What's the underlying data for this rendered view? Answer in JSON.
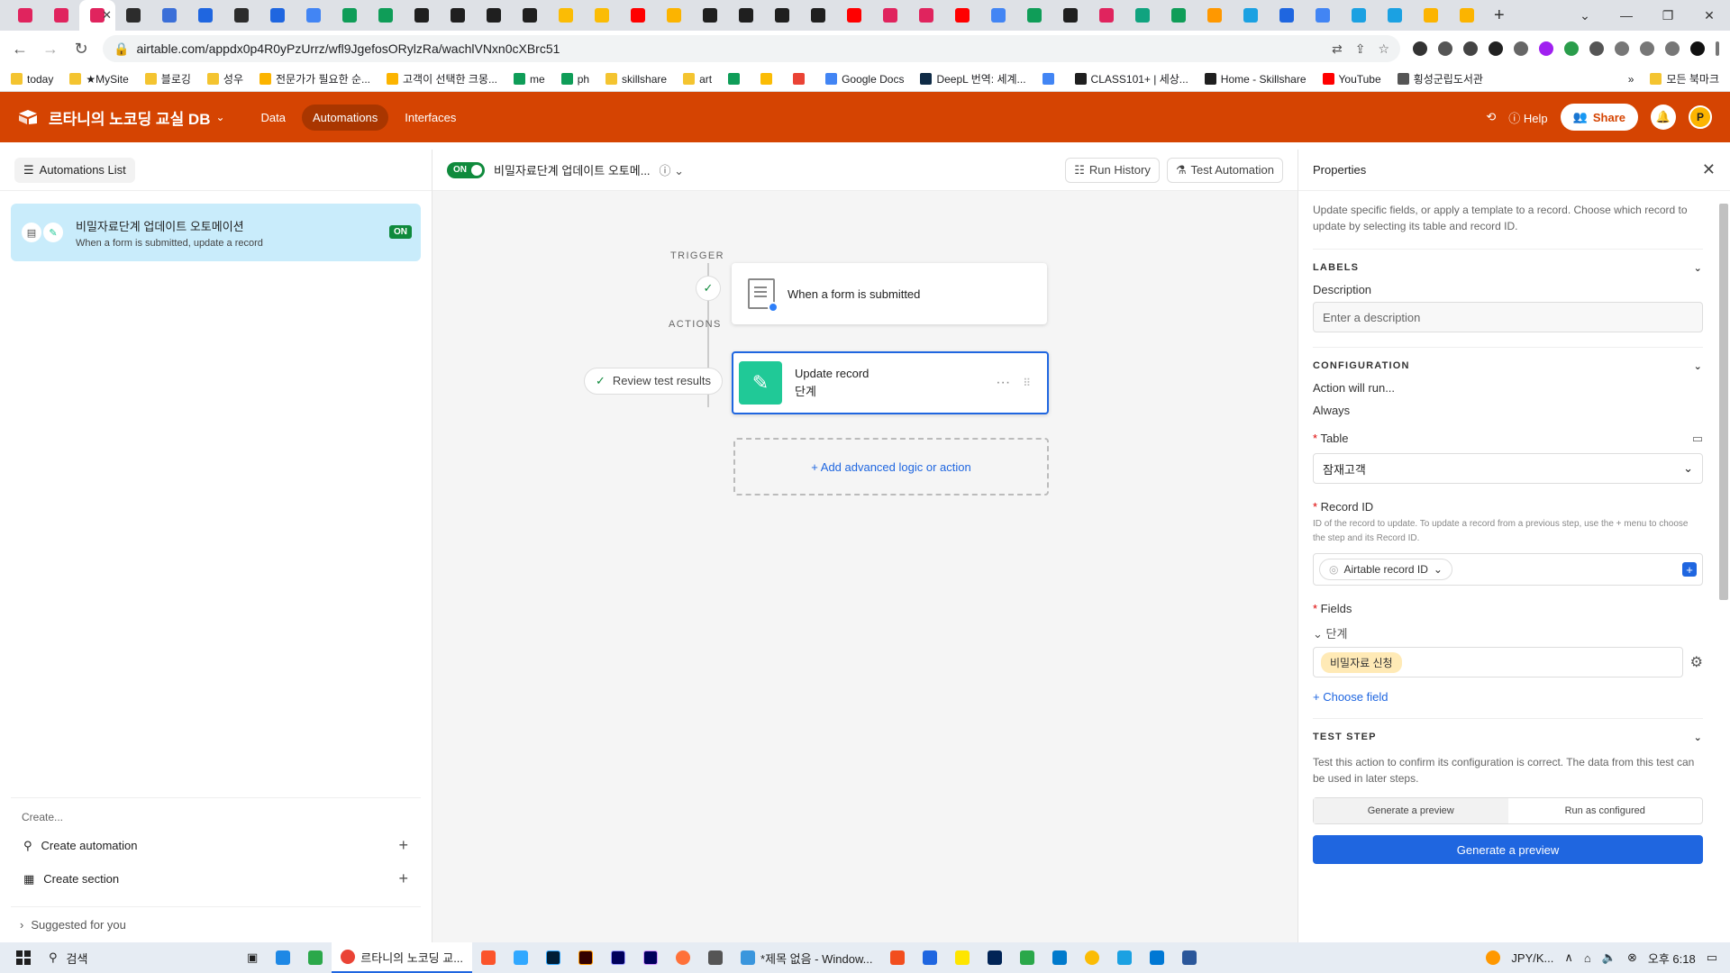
{
  "browser": {
    "tab_colors": [
      "#e0245e",
      "#e0245e",
      "#e0245e",
      "#2c2c2c",
      "#3b6fd8",
      "#1f66e0",
      "#2c2c2c",
      "#1f66e0",
      "#4285f4",
      "#0f9d58",
      "#0f9d58",
      "#1f1f1f",
      "#1f1f1f",
      "#1f1f1f",
      "#1f1f1f",
      "#fbbc05",
      "#fbbc05",
      "#ff0000",
      "#fcb400",
      "#1f1f1f",
      "#1f1f1f",
      "#1f1f1f",
      "#1f1f1f",
      "#ff0000",
      "#e0245e",
      "#e0245e",
      "#ff0000",
      "#4285f4",
      "#0f9d58",
      "#1f1f1f",
      "#e0245e",
      "#10a37f",
      "#0f9d58",
      "#ff9800",
      "#1ba1e2",
      "#1f66e0",
      "#4285f4",
      "#1ba1e2",
      "#1ba1e2",
      "#fcb400",
      "#fcb400"
    ],
    "url": "airtable.com/appdx0p4R0yPzUrrz/wfl9JgefosORylzRa/wachlVNxn0cXBrc51",
    "bookmarks": [
      {
        "label": "today",
        "color": "#f4c430"
      },
      {
        "label": "★MySite",
        "color": "#f4c430"
      },
      {
        "label": "블로깅",
        "color": "#f4c430"
      },
      {
        "label": "성우",
        "color": "#f4c430"
      },
      {
        "label": "전문가가 필요한 순...",
        "color": "#fcb400"
      },
      {
        "label": "고객이 선택한 크몽...",
        "color": "#fcb400"
      },
      {
        "label": "me",
        "color": "#0f9d58"
      },
      {
        "label": "ph",
        "color": "#0f9d58"
      },
      {
        "label": "skillshare",
        "color": "#f4c430"
      },
      {
        "label": "art",
        "color": "#f4c430"
      },
      {
        "label": "",
        "color": "#0f9d58"
      },
      {
        "label": "",
        "color": "#fbbc05"
      },
      {
        "label": "",
        "color": "#ea4335"
      },
      {
        "label": "Google Docs",
        "color": "#4285f4"
      },
      {
        "label": "DeepL 번역: 세계...",
        "color": "#0f2b46"
      },
      {
        "label": "",
        "color": "#4285f4"
      },
      {
        "label": "CLASS101+ | 세상...",
        "color": "#1f1f1f"
      },
      {
        "label": "Home - Skillshare",
        "color": "#1f1f1f"
      },
      {
        "label": "YouTube",
        "color": "#ff0000"
      },
      {
        "label": "횡성군립도서관",
        "color": "#555555"
      }
    ],
    "bookmarks_more": "»",
    "all_bookmarks": "모든 북마크"
  },
  "header": {
    "base_name": "르타니의 노코딩 교실 DB",
    "nav": [
      "Data",
      "Automations",
      "Interfaces"
    ],
    "help": "Help",
    "share": "Share",
    "avatar_initial": "P",
    "brand_color": "#d54402"
  },
  "left": {
    "list_button": "Automations List",
    "automation": {
      "title": "비밀자료단계 업데이트 오토메이션",
      "subtitle": "When a form is submitted, update a record",
      "status": "ON"
    },
    "create_label": "Create...",
    "create_automation": "Create automation",
    "create_section": "Create section",
    "suggested": "Suggested for you"
  },
  "center": {
    "toggle": "ON",
    "automation_name": "비밀자료단계 업데이트 오토메...",
    "run_history": "Run History",
    "test_automation": "Test Automation",
    "trigger_label": "TRIGGER",
    "actions_label": "ACTIONS",
    "trigger_step": "When a form is submitted",
    "action_title": "Update record",
    "action_sub": "단계",
    "review": "Review test results",
    "add_logic": "+ Add advanced logic or action"
  },
  "right": {
    "title": "Properties",
    "description": "Update specific fields, or apply a template to a record. Choose which record to update by selecting its table and record ID.",
    "labels_header": "LABELS",
    "description_label": "Description",
    "description_placeholder": "Enter a description",
    "config_header": "CONFIGURATION",
    "action_will_run": "Action will run...",
    "always": "Always",
    "table_label": "Table",
    "table_value": "잠재고객",
    "record_id_label": "Record ID",
    "record_id_help": "ID of the record to update. To update a record from a previous step, use the + menu to choose the step and its Record ID.",
    "record_id_pill": "Airtable record ID",
    "fields_label": "Fields",
    "field_name": "단계",
    "field_value": "비밀자료 신청",
    "choose_field": "+ Choose field",
    "test_header": "TEST STEP",
    "test_desc": "Test this action to confirm its configuration is correct. The data from this test can be used in later steps.",
    "tab_preview": "Generate a preview",
    "tab_configured": "Run as configured",
    "generate_button": "Generate a preview"
  },
  "taskbar": {
    "search": "검색",
    "app1": "르타니의 노코딩 교...",
    "app2": "*제목 없음 - Window...",
    "lang": "JPY/K...",
    "time": "오후 6:18"
  }
}
